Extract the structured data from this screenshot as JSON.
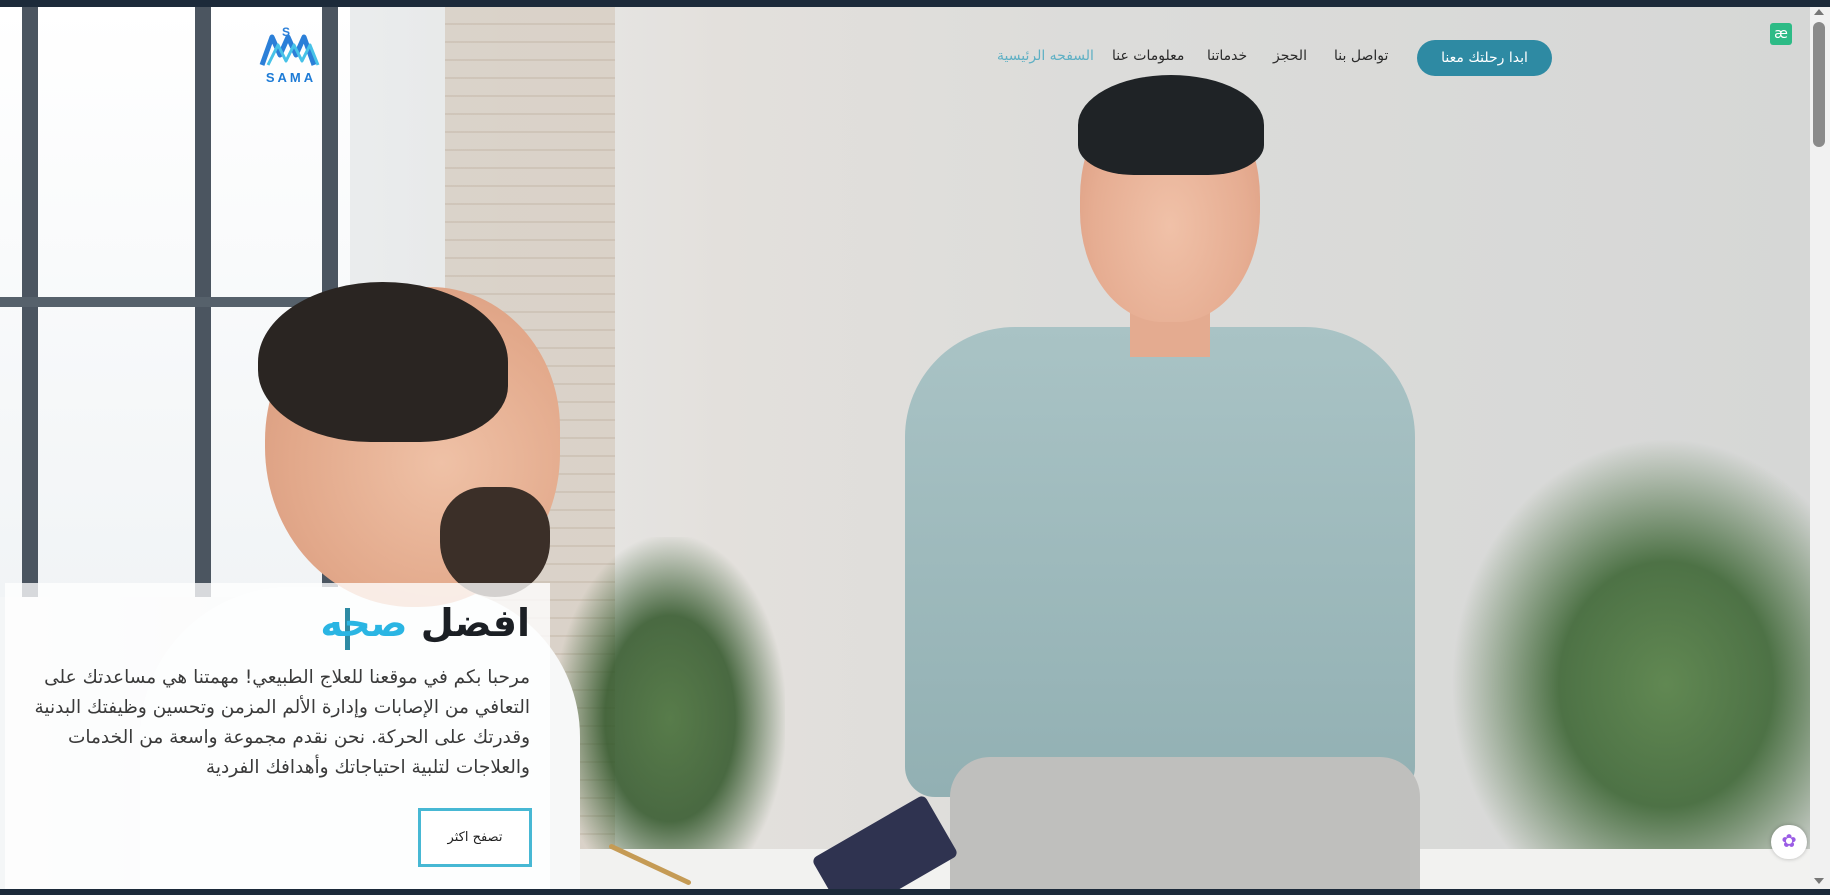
{
  "header": {
    "logo_text": "SAMA",
    "nav": [
      {
        "label": "السفحه الرئيسية",
        "active": true
      },
      {
        "label": "معلومات عنا",
        "active": false
      },
      {
        "label": "خدماتنا",
        "active": false
      },
      {
        "label": "الحجز",
        "active": false
      },
      {
        "label": "تواصل بنا",
        "active": false
      }
    ],
    "cta_label": "ابدا رحلتك معنا",
    "extension_badge": "æ"
  },
  "hero": {
    "title_main": "افضل",
    "title_accent": "صحه",
    "description": "مرحبا بكم في موقعنا للعلاج الطبيعي! مهمتنا هي مساعدتك على التعافي من الإصابات وإدارة الألم المزمن وتحسين وظيفتك البدنية وقدرتك على الحركة. نحن نقدم مجموعة واسعة من الخدمات والعلاجات لتلبية احتياجاتك وأهدافك الفردية",
    "browse_label": "تصفح اكثر"
  },
  "colors": {
    "accent": "#2e8aa3",
    "title_accent": "#2ab5e3",
    "nav_active": "#5fb0c4"
  },
  "icons": {
    "brain": "brain-icon",
    "extension": "ae-extension-icon"
  }
}
